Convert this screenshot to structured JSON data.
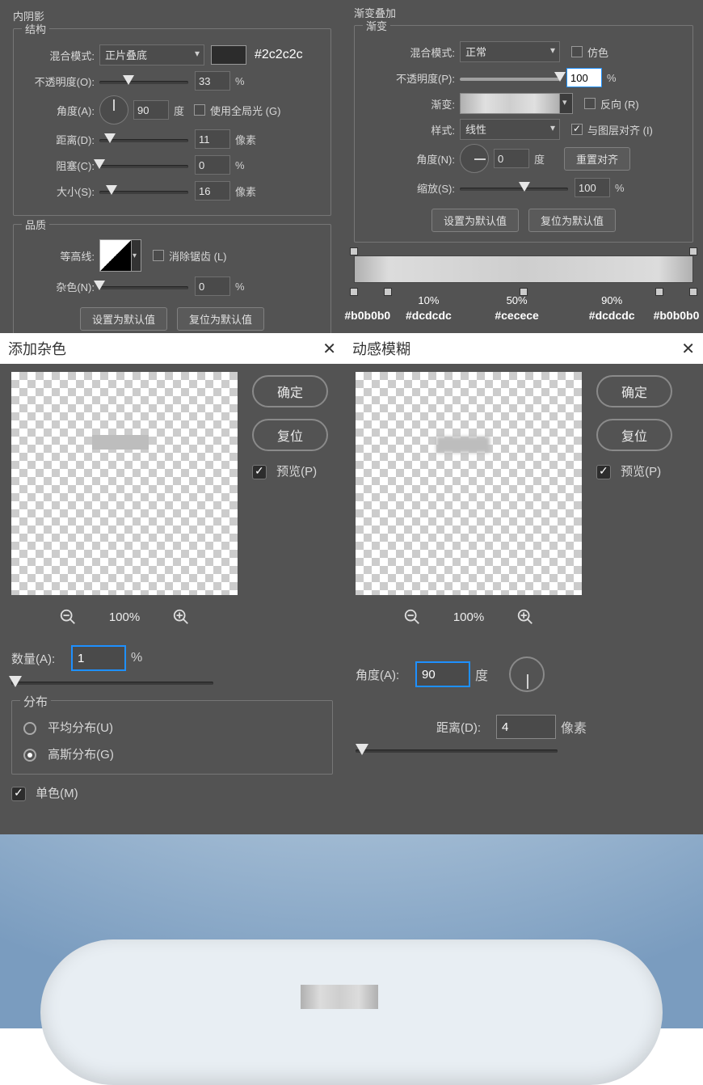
{
  "innerShadow": {
    "title": "内阴影",
    "structure": "结构",
    "blendModeLbl": "混合模式:",
    "blendMode": "正片叠底",
    "colorHex": "#2c2c2c",
    "opacityLbl": "不透明度(O):",
    "opacity": "33",
    "opacityUnit": "%",
    "angleLbl": "角度(A):",
    "angleVal": "90",
    "angleUnit": "度",
    "useGlobalLight": "使用全局光 (G)",
    "distanceLbl": "距离(D):",
    "distance": "11",
    "distanceUnit": "像素",
    "chokeLbl": "阻塞(C):",
    "choke": "0",
    "chokeUnit": "%",
    "sizeLbl": "大小(S):",
    "size": "16",
    "sizeUnit": "像素",
    "quality": "品质",
    "contourLbl": "等高线:",
    "antiAlias": "消除锯齿 (L)",
    "noiseLbl": "杂色(N):",
    "noise": "0",
    "noiseUnit": "%",
    "setDefault": "设置为默认值",
    "resetDefault": "复位为默认值"
  },
  "gradientOverlay": {
    "title": "渐变叠加",
    "section": "渐变",
    "blendModeLbl": "混合模式:",
    "blendMode": "正常",
    "ditherLbl": "仿色",
    "opacityLbl": "不透明度(P):",
    "opacity": "100",
    "opacityUnit": "%",
    "gradientLbl": "渐变:",
    "reverseLbl": "反向 (R)",
    "styleLbl": "样式:",
    "style": "线性",
    "alignLbl": "与图层对齐 (I)",
    "angleLbl": "角度(N):",
    "angle": "0",
    "angleUnit": "度",
    "resetAlign": "重置对齐",
    "scaleLbl": "缩放(S):",
    "scale": "100",
    "scaleUnit": "%",
    "setDefault": "设置为默认值",
    "resetDefault": "复位为默认值",
    "stops": [
      {
        "pos": "0%",
        "pct": "",
        "hex": "#b0b0b0"
      },
      {
        "pos": "10%",
        "pct": "10%",
        "hex": "#dcdcdc"
      },
      {
        "pos": "50%",
        "pct": "50%",
        "hex": "#cecece"
      },
      {
        "pos": "90%",
        "pct": "90%",
        "hex": "#dcdcdc"
      },
      {
        "pos": "100%",
        "pct": "",
        "hex": "#b0b0b0"
      }
    ]
  },
  "addNoise": {
    "title": "添加杂色",
    "ok": "确定",
    "reset": "复位",
    "previewLbl": "预览(P)",
    "zoom": "100%",
    "amountLbl": "数量(A):",
    "amount": "1",
    "amountUnit": "%",
    "distribution": "分布",
    "uniform": "平均分布(U)",
    "gaussian": "高斯分布(G)",
    "monoLbl": "单色(M)"
  },
  "motionBlur": {
    "title": "动感模糊",
    "ok": "确定",
    "reset": "复位",
    "previewLbl": "预览(P)",
    "zoom": "100%",
    "angleLbl": "角度(A):",
    "angle": "90",
    "angleUnit": "度",
    "distanceLbl": "距离(D):",
    "distance": "4",
    "distanceUnit": "像素"
  }
}
